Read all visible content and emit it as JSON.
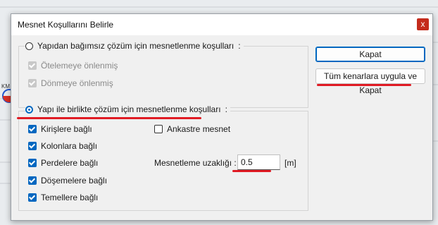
{
  "dialog": {
    "title": "Mesnet Koşullarını Belirle",
    "close_glyph": "x"
  },
  "group_independent": {
    "radio_label": "Yapıdan bağımsız çözüm için mesnetlenme koşulları",
    "radio_suffix": ":",
    "checked": false,
    "options": [
      {
        "label": "Ötelemeye önlenmiş",
        "checked": true,
        "disabled": true
      },
      {
        "label": "Dönmeye önlenmiş",
        "checked": true,
        "disabled": true
      }
    ]
  },
  "group_with_structure": {
    "radio_label": "Yapı ile birlikte çözüm için mesnetlenme koşulları",
    "radio_suffix": ":",
    "checked": true,
    "options": [
      {
        "label": "Kirişlere bağlı",
        "checked": true
      },
      {
        "label": "Kolonlara bağlı",
        "checked": true
      },
      {
        "label": "Perdelere bağlı",
        "checked": true
      },
      {
        "label": "Döşemelere bağlı",
        "checked": true
      },
      {
        "label": "Temellere bağlı",
        "checked": true
      }
    ],
    "fixed_support": {
      "label": "Ankastre mesnet",
      "checked": false
    },
    "distance": {
      "label": "Mesnetleme uzaklığı :",
      "value": "0.5",
      "unit": "[m]"
    }
  },
  "buttons": {
    "close": "Kapat",
    "apply_all": "Tüm kenarlara uygula ve Kapat"
  },
  "background": {
    "label": "KM"
  },
  "colors": {
    "accent": "#0067c0",
    "annotation_red": "#e01b24",
    "close_red": "#c42b1c"
  }
}
